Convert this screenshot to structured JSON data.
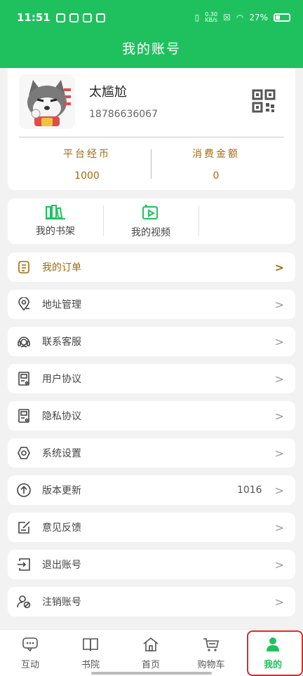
{
  "status_bar": {
    "time": "11:51",
    "net_speed_value": "0.30",
    "net_speed_unit": "KB/s",
    "battery": "27%"
  },
  "header": {
    "title": "我的账号"
  },
  "profile": {
    "username": "太尴尬",
    "user_id": "18786636067",
    "stats": [
      {
        "label": "平台经币",
        "value": "1000"
      },
      {
        "label": "消费金额",
        "value": "0"
      }
    ]
  },
  "quick_links": [
    {
      "label": "我的书架",
      "icon": "bookshelf-icon"
    },
    {
      "label": "我的视频",
      "icon": "video-icon"
    }
  ],
  "menu": [
    {
      "label": "我的订单",
      "icon": "order-icon",
      "chevron": ">"
    },
    {
      "label": "地址管理",
      "icon": "location-icon",
      "chevron": ">"
    },
    {
      "label": "联系客服",
      "icon": "headset-icon",
      "chevron": ">"
    },
    {
      "label": "用户协议",
      "icon": "document-icon",
      "chevron": ">"
    },
    {
      "label": "隐私协议",
      "icon": "document-icon",
      "chevron": ">"
    },
    {
      "label": "系统设置",
      "icon": "settings-icon",
      "chevron": ">"
    },
    {
      "label": "版本更新",
      "icon": "upgrade-icon",
      "value": "1016",
      "chevron": ">"
    },
    {
      "label": "意见反馈",
      "icon": "feedback-icon",
      "chevron": ">"
    },
    {
      "label": "退出账号",
      "icon": "logout-icon",
      "chevron": ">"
    },
    {
      "label": "注销账号",
      "icon": "delete-user-icon",
      "chevron": ">"
    }
  ],
  "tabs": [
    {
      "label": "互动",
      "icon": "chat-icon"
    },
    {
      "label": "书院",
      "icon": "book-icon"
    },
    {
      "label": "首页",
      "icon": "home-icon"
    },
    {
      "label": "购物车",
      "icon": "cart-icon"
    },
    {
      "label": "我的",
      "icon": "user-icon",
      "active": true
    }
  ],
  "colors": {
    "brand_green": "#1fc15e",
    "accent_gold": "#a06a10",
    "highlight_red": "#e02828"
  }
}
